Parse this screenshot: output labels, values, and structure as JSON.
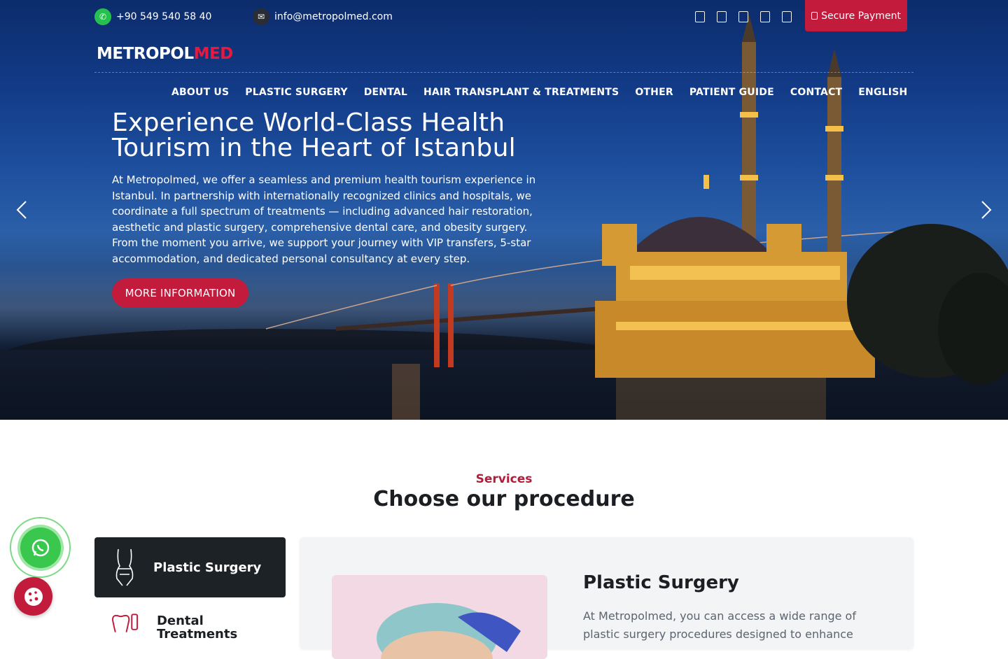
{
  "topbar": {
    "phone": "+90 549 540 58 40",
    "email": "info@metropolmed.com",
    "secure_payment": "Secure Payment",
    "social_icons": [
      "facebook-icon",
      "instagram-icon",
      "youtube-icon",
      "twitter-icon",
      "linkedin-icon"
    ]
  },
  "logo": {
    "part1": "METROPOL",
    "part2": "MED"
  },
  "nav": {
    "items": [
      "ABOUT US",
      "PLASTIC SURGERY",
      "DENTAL",
      "HAIR TRANSPLANT & TREATMENTS",
      "OTHER",
      "PATIENT GUIDE",
      "CONTACT",
      "ENGLISH"
    ]
  },
  "hero": {
    "title": "Experience World-Class Health Tourism in the Heart of Istanbul",
    "text": "At Metropolmed, we offer a seamless and premium health tourism experience in Istanbul. In partnership with internationally recognized clinics and hospitals, we coordinate a full spectrum of treatments — including advanced hair restoration, aesthetic and plastic surgery, comprehensive dental care, and obesity surgery. From the moment you arrive, we support your journey with VIP transfers, 5-star accommodation, and dedicated personal consultancy at every step.",
    "button": "MORE INFORMATION"
  },
  "services": {
    "eyebrow": "Services",
    "title": "Choose our procedure",
    "tabs": [
      "Plastic Surgery",
      "Dental Treatments"
    ],
    "active": {
      "title": "Plastic Surgery",
      "text": "At Metropolmed, you can access a wide range of plastic surgery procedures designed to enhance"
    }
  },
  "colors": {
    "accent": "#c21b3c",
    "dark": "#1d2227",
    "whatsapp": "#39c74e"
  }
}
